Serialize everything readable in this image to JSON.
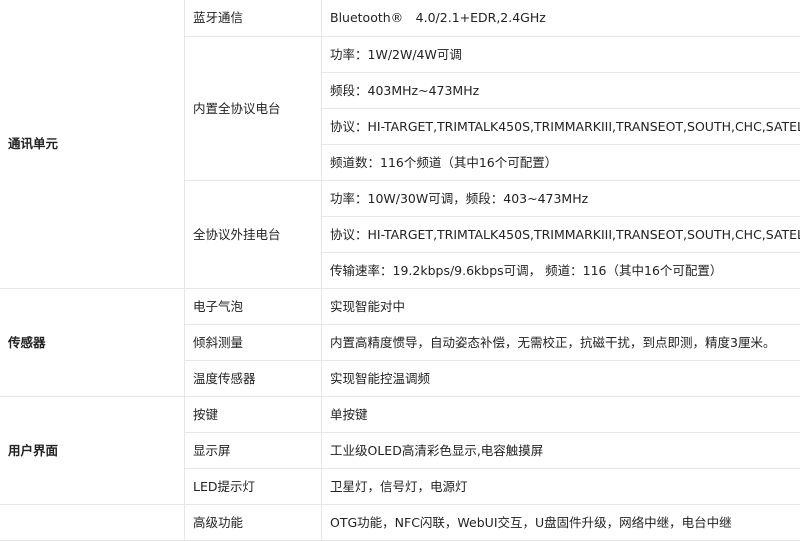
{
  "spec_table": {
    "rows": [
      {
        "cat": "通讯单元",
        "sub": "蓝牙通信",
        "val": "Bluetooth®　4.0/2.1+EDR,2.4GHz"
      },
      {
        "sub": "内置全协议电台",
        "val": "功率：1W/2W/4W可调"
      },
      {
        "val": "频段：403MHz~473MHz"
      },
      {
        "val": "协议：HI-TARGET,TRIMTALK450S,TRIMMARKIII,TRANSEOT,SOUTH,CHC,SATEL"
      },
      {
        "val": "频道数：116个频道（其中16个可配置）"
      },
      {
        "sub": "全协议外挂电台",
        "val": "功率：10W/30W可调，频段：403~473MHz"
      },
      {
        "val": "协议：HI-TARGET,TRIMTALK450S,TRIMMARKIII,TRANSEOT,SOUTH,CHC,SATEL"
      },
      {
        "val": "传输速率：19.2kbps/9.6kbps可调， 频道：116（其中16个可配置）"
      },
      {
        "cat": "传感器",
        "sub": "电子气泡",
        "val": "实现智能对中"
      },
      {
        "sub": "倾斜测量",
        "val": "内置高精度惯导，自动姿态补偿，无需校正，抗磁干扰，到点即测，精度3厘米。"
      },
      {
        "sub": "温度传感器",
        "val": "实现智能控温调频"
      },
      {
        "cat": "用户界面",
        "sub": "按键",
        "val": "单按键"
      },
      {
        "sub": "显示屏",
        "val": "工业级OLED高清彩色显示,电容触摸屏"
      },
      {
        "sub": "LED提示灯",
        "val": "卫星灯，信号灯，电源灯"
      },
      {
        "sub": "高级功能",
        "val": "OTG功能，NFC闪联，WebUI交互，U盘固件升级，网络中继，电台中继"
      }
    ]
  }
}
